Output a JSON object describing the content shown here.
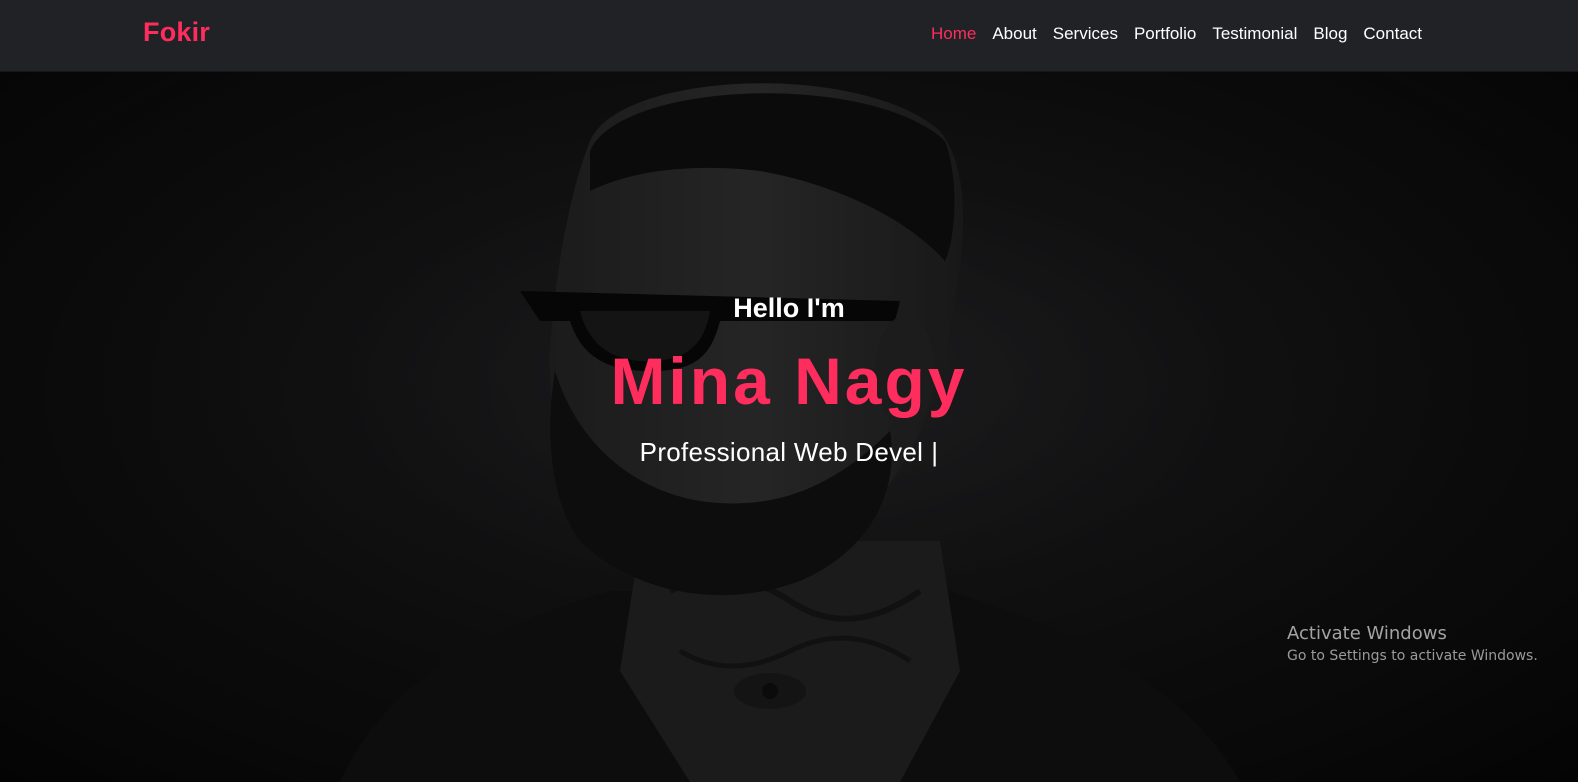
{
  "nav": {
    "brand": "Fokir",
    "links": [
      {
        "label": "Home",
        "active": true
      },
      {
        "label": "About",
        "active": false
      },
      {
        "label": "Services",
        "active": false
      },
      {
        "label": "Portfolio",
        "active": false
      },
      {
        "label": "Testimonial",
        "active": false
      },
      {
        "label": "Blog",
        "active": false
      },
      {
        "label": "Contact",
        "active": false
      }
    ]
  },
  "hero": {
    "greeting": "Hello I'm",
    "name": "Mina Nagy",
    "role": "Professional Web Devel",
    "cursor": "|",
    "background_image": "bearded-man-sunglasses-tattoo-photo"
  },
  "watermark": {
    "title": "Activate Windows",
    "subtitle": "Go to Settings to activate Windows."
  },
  "colors": {
    "accent": "#ff2d5e",
    "navbar": "#202226",
    "text": "#ffffff"
  }
}
